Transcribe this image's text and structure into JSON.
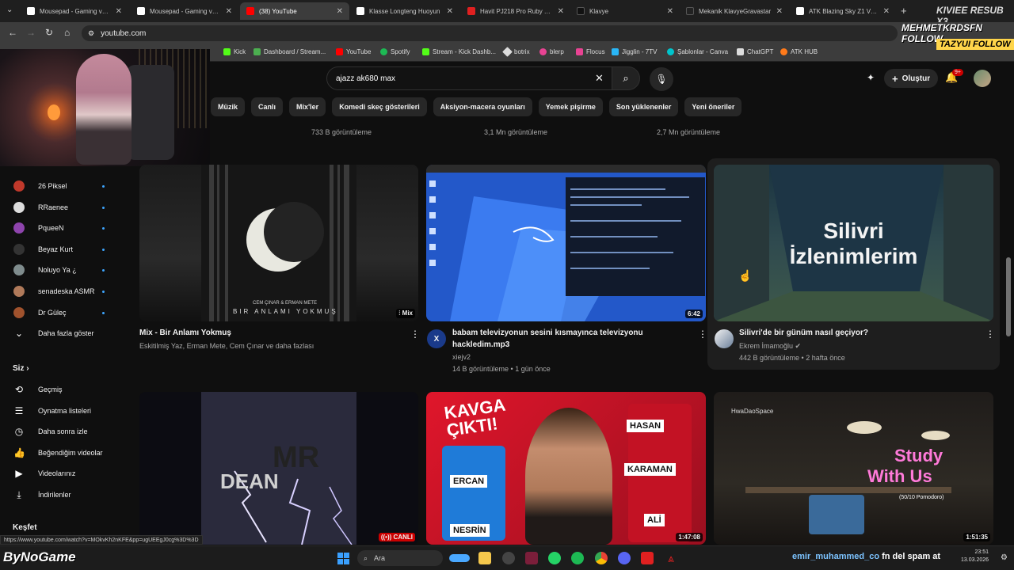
{
  "tabs": [
    {
      "label": "Mousepad - Gaming ve O",
      "color": "#ffffff"
    },
    {
      "label": "Mousepad - Gaming ve O",
      "color": "#ffffff"
    },
    {
      "label": "(38) YouTube",
      "color": "#ff0000"
    },
    {
      "label": "Klasse Longteng Huoyun",
      "color": "#ffffff"
    },
    {
      "label": "Havit PJ218 Pro Ruby Taş",
      "color": "#e02020"
    },
    {
      "label": "Klavye",
      "color": "#111111"
    },
    {
      "label": "Mekanik KlavyeGravastar",
      "color": "#222222"
    },
    {
      "label": "ATK Blazing Sky Z1 V2 W",
      "color": "#ffffff"
    }
  ],
  "address": {
    "url": "youtube.com"
  },
  "bookmarks": [
    "Kick",
    "Dashboard / Stream...",
    "YouTube",
    "Spotify",
    "Stream - Kick Dashb...",
    "botrix",
    "blerp",
    "Flocus",
    "Jigglin - 7TV",
    "Şablonlar - Canva",
    "ChatGPT",
    "ATK HUB"
  ],
  "header": {
    "search_value": "ajazz ak680 max",
    "create_label": "Oluştur",
    "notif_count": "9+"
  },
  "chips": [
    "Müzik",
    "Canlı",
    "Mix'ler",
    "Komedi skeç gösterileri",
    "Aksiyon-macera oyunları",
    "Yemek pişirme",
    "Son yüklenenler",
    "Yeni öneriler"
  ],
  "top_row_meta": [
    "733 B görüntüleme",
    "3,1 Mn görüntüleme",
    "2,7 Mn görüntüleme"
  ],
  "sidebar": {
    "subscriptions": [
      {
        "name": "26 Piksel",
        "color": "#c0392b"
      },
      {
        "name": "RRaenee",
        "color": "#dddddd"
      },
      {
        "name": "PqueeN",
        "color": "#8e44ad"
      },
      {
        "name": "Beyaz Kurt",
        "color": "#333333"
      },
      {
        "name": "Noluyo Ya ¿",
        "color": "#7f8c8d"
      },
      {
        "name": "senadeska ASMR",
        "color": "#b07a5a"
      },
      {
        "name": "Dr Güleç",
        "color": "#a0522d"
      }
    ],
    "show_more": "Daha fazla göster",
    "you_heading": "Siz",
    "you_items": [
      "Geçmiş",
      "Oynatma listeleri",
      "Daha sonra izle",
      "Beğendiğim videolar",
      "Videolarınız",
      "İndirilenler"
    ],
    "explore_heading": "Keşfet"
  },
  "videos": [
    {
      "title": "Mix - Bir Anlamı Yokmuş",
      "meta1": "Eskitilmiş Yaz, Erman Mete, Cem Çınar ve daha fazlası",
      "meta2": "",
      "badge": "Mix",
      "thumb_text": "BIR ANLAMI YOKMUŞ",
      "thumb_sub": "CEM ÇINAR & ERMAN METE"
    },
    {
      "title_line1": "babam televizyonun sesini kısmayınca televizyonu",
      "title_line2": "hackledim.mp3",
      "channel": "xiejv2",
      "meta": "14 B görüntüleme • 1 gün önce",
      "duration": "6:42",
      "avatar_letter": "X"
    },
    {
      "title": "Silivri'de bir günüm nasıl geçiyor?",
      "channel": "Ekrem İmamoğlu",
      "meta": "442 B görüntüleme • 2 hafta önce",
      "thumb_line1": "Silivri",
      "thumb_line2": "İzlenimlerim"
    },
    {
      "thumb_text": "DEAN",
      "thumb_logo": "MR",
      "badge": "CANLI"
    },
    {
      "duration": "1:47:08",
      "thumb_title": "KAVGA ÇIKTI!",
      "names": [
        "ERCAN",
        "NESRİN",
        "HASAN",
        "KARAMAN",
        "ALİ"
      ]
    },
    {
      "duration": "1:51:35",
      "thumb_brand": "HwaDaoSpace",
      "thumb_line1": "Study",
      "thumb_line2": "With Us",
      "thumb_sub": "(50/10 Pomodoro)"
    }
  ],
  "overlay": {
    "tag1": "MEHMETKRDSFN",
    "tag1b": "FOLLOW",
    "tag2": "TAZYUI",
    "tag2b": "FOLLOW",
    "top_right_a": "KIVIEE",
    "top_right_b": "RESUB X3",
    "brand": "ByNoGame",
    "chat_user": "emir_muhammed_co",
    "chat_text": "fn del spam at"
  },
  "status_url": "https://www.youtube.com/watch?v=MOkvKh2nKFE&pp=ugUEEgJ0cg%3D%3D",
  "taskbar": {
    "search_label": "Ara",
    "time": "23:51",
    "date": "13.03.2026"
  }
}
